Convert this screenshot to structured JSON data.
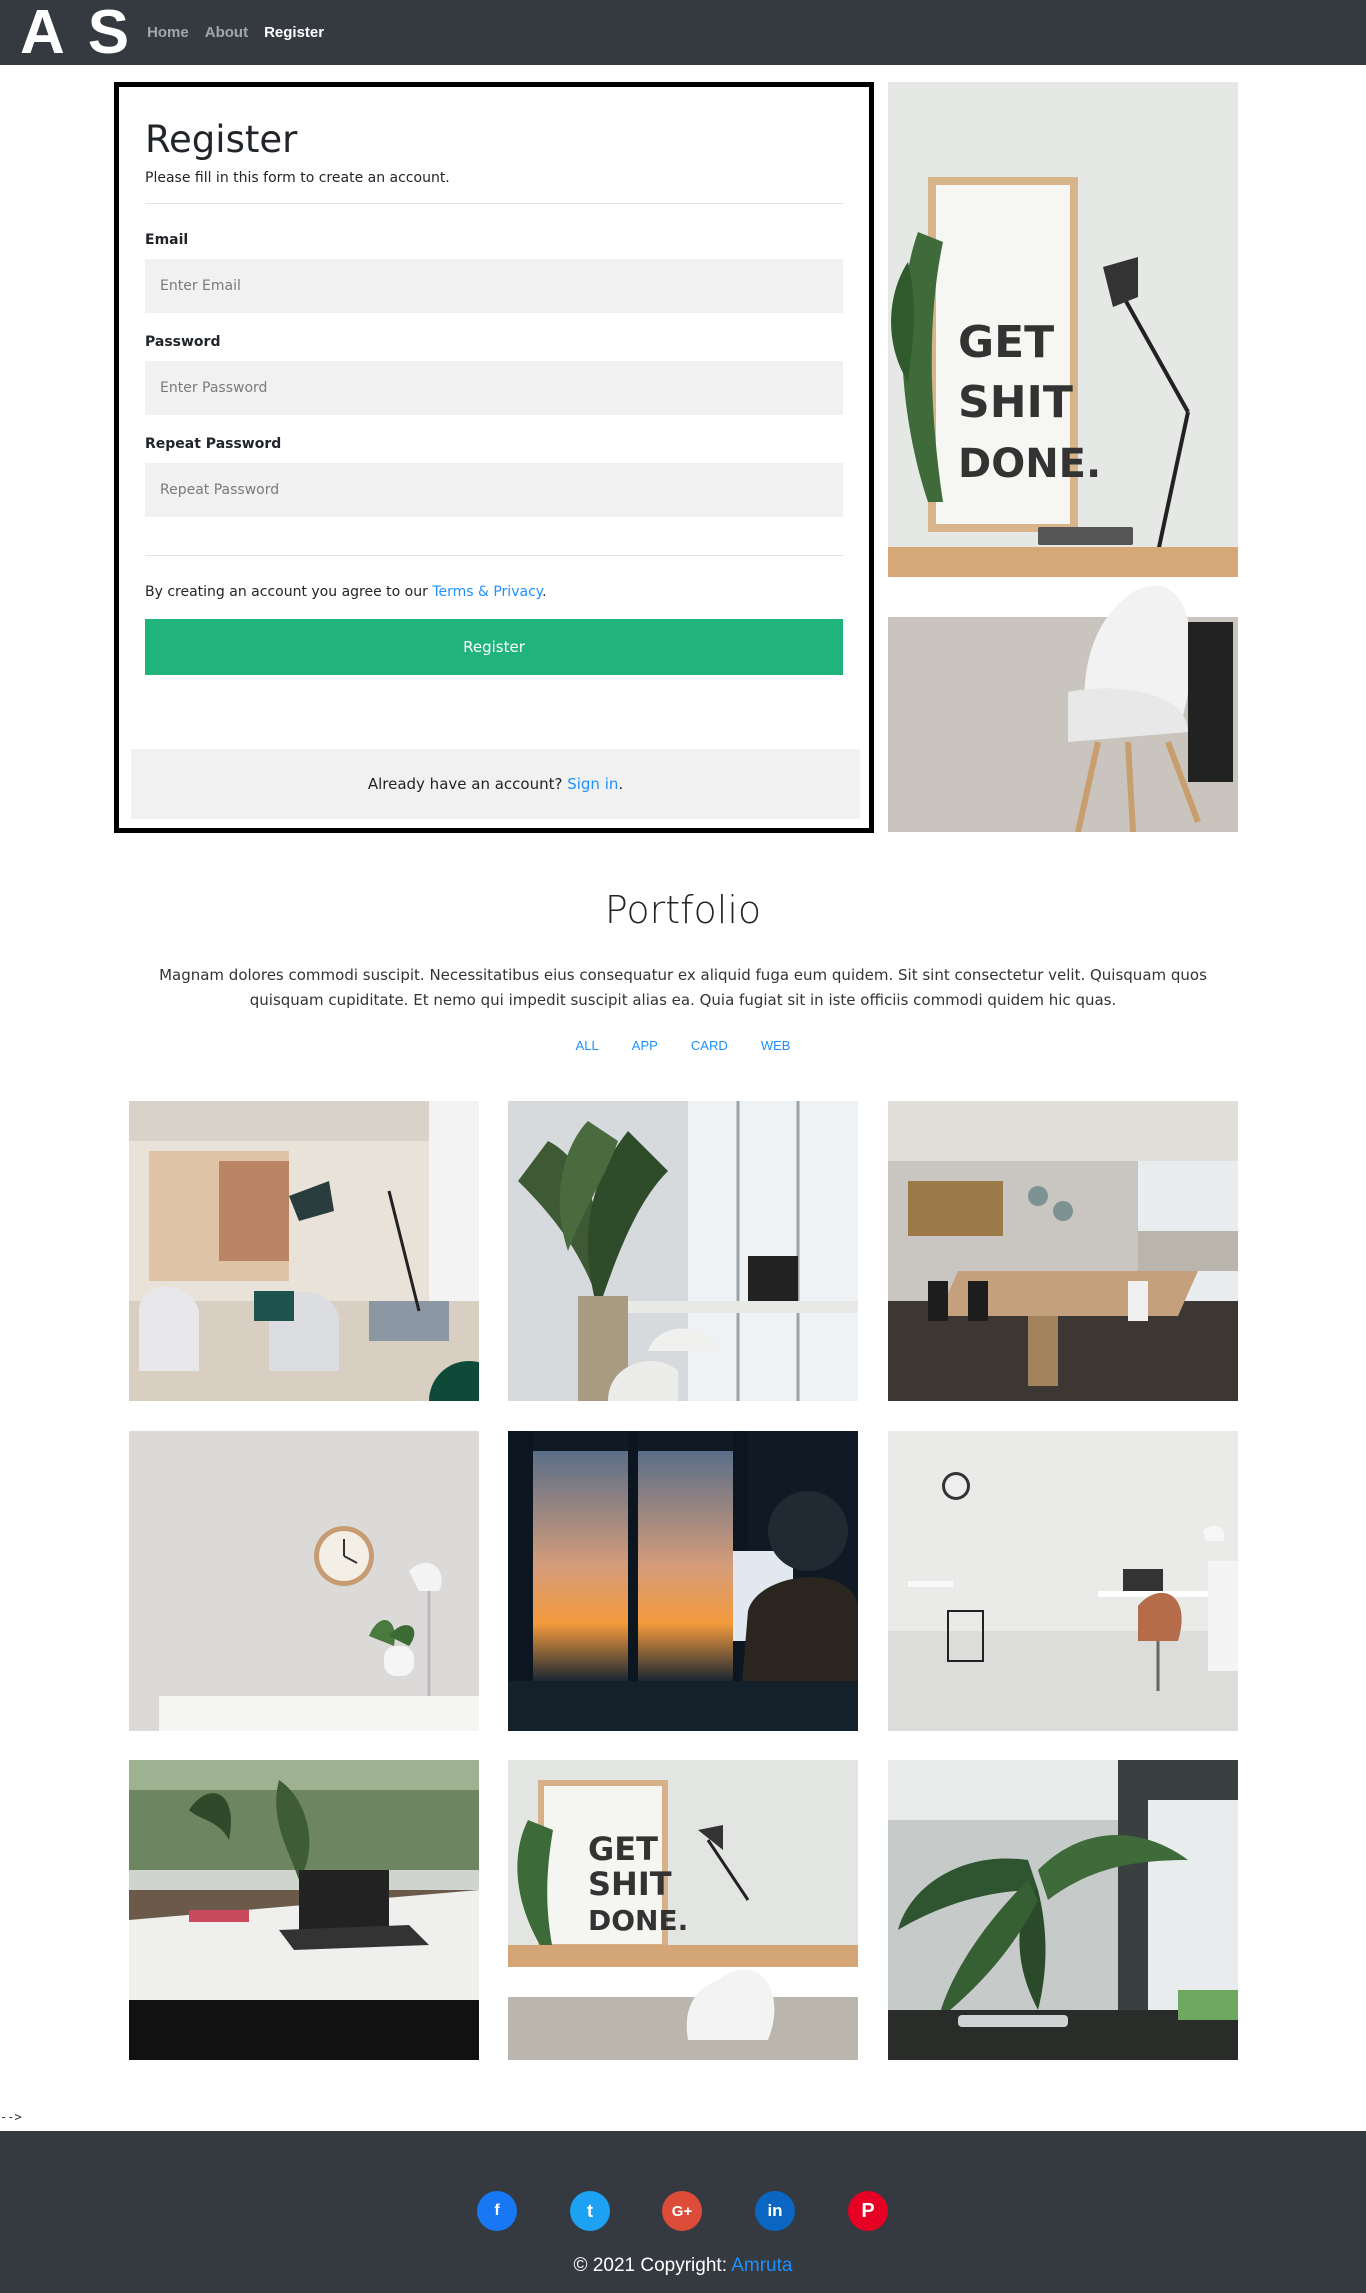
{
  "nav": {
    "brand": "A S",
    "links": [
      {
        "label": "Home",
        "active": false
      },
      {
        "label": "About",
        "active": false
      },
      {
        "label": "Register",
        "active": true
      }
    ]
  },
  "register": {
    "title": "Register",
    "subtitle": "Please fill in this form to create an account.",
    "email_label": "Email",
    "email_placeholder": "Enter Email",
    "password_label": "Password",
    "password_placeholder": "Enter Password",
    "repeat_label": "Repeat Password",
    "repeat_placeholder": "Repeat Password",
    "terms_prefix": "By creating an account you agree to our ",
    "terms_link": "Terms & Privacy",
    "terms_suffix": ".",
    "button_label": "Register",
    "signin_prefix": "Already have an account? ",
    "signin_link": "Sign in",
    "signin_suffix": "."
  },
  "hero": {
    "poster_lines": [
      "GET",
      "SHIT",
      "DONE."
    ]
  },
  "portfolio": {
    "title": "Portfolio",
    "description": "Magnam dolores commodi suscipit. Necessitatibus eius consequatur ex aliquid fuga eum quidem. Sit sint consectetur velit. Quisquam quos quisquam cupiditate. Et nemo qui impedit suscipit alias ea. Quia fugiat sit in iste officiis commodi quidem hic quas.",
    "filters": [
      "ALL",
      "APP",
      "CARD",
      "WEB"
    ]
  },
  "comment_artifact": "-->",
  "footer": {
    "social": [
      {
        "icon": "facebook-icon",
        "glyph": "f",
        "color": "#1877f2"
      },
      {
        "icon": "twitter-icon",
        "glyph": "t",
        "color": "#1da1f2"
      },
      {
        "icon": "google-plus-icon",
        "glyph": "G+",
        "color": "#dd4b39"
      },
      {
        "icon": "linkedin-icon",
        "glyph": "in",
        "color": "#0a66c2"
      },
      {
        "icon": "pinterest-icon",
        "glyph": "P",
        "color": "#e60023"
      }
    ],
    "copyright_prefix": "© 2021 Copyright: ",
    "copyright_link": "Amruta"
  },
  "colors": {
    "navbar": "#343a40",
    "accent_button": "#20b47c",
    "link": "#1e90ff"
  }
}
